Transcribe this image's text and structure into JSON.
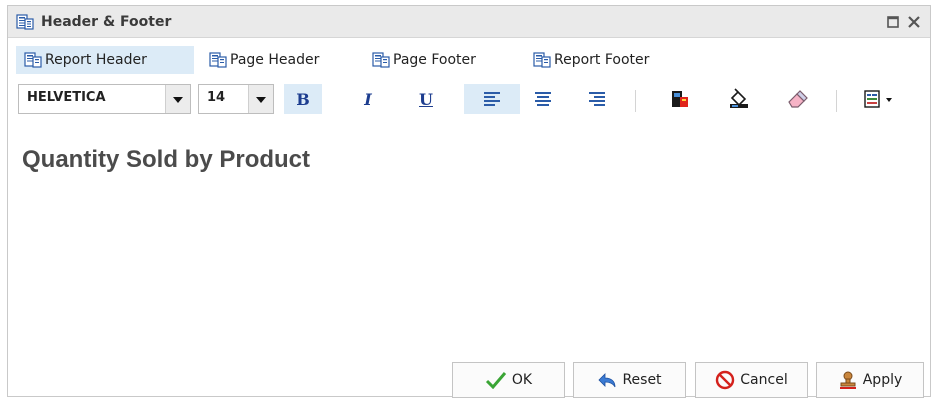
{
  "window": {
    "title": "Header & Footer"
  },
  "tabs": [
    {
      "label": "Report Header",
      "active": true
    },
    {
      "label": "Page Header",
      "active": false
    },
    {
      "label": "Page Footer",
      "active": false
    },
    {
      "label": "Report Footer",
      "active": false
    }
  ],
  "toolbar": {
    "font_value": "HELVETICA",
    "size_value": "14",
    "bold_label": "B",
    "italic_label": "I",
    "underline_label": "U"
  },
  "content": {
    "text": "Quantity Sold by Product"
  },
  "buttons": {
    "ok_label": "OK",
    "reset_label": "Reset",
    "cancel_label": "Cancel",
    "apply_label": "Apply"
  },
  "colors": {
    "accent": "#dcebf7",
    "title_bar": "#eaeaea",
    "text": "#4b4b4b"
  }
}
